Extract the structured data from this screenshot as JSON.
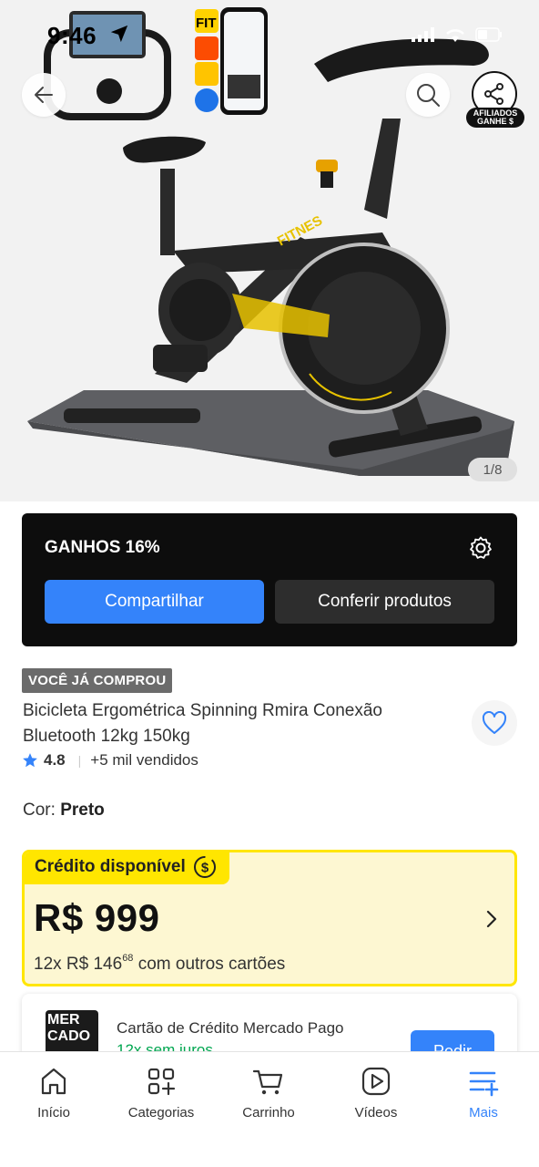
{
  "status_bar": {
    "time": "9:46"
  },
  "hero": {
    "affiliate_badge_line1": "AFILIADOS",
    "affiliate_badge_line2": "GANHE $",
    "image_counter": "1/8",
    "product_print": "FITNES"
  },
  "affiliate_panel": {
    "title": "GANHOS 16%",
    "share_label": "Compartilhar",
    "check_products_label": "Conferir produtos"
  },
  "product": {
    "bought_tag": "VOCÊ JÁ COMPROU",
    "title": "Bicicleta Ergométrica Spinning Rmira Conexão Bluetooth 12kg 150kg",
    "rating": "4.8",
    "sold": "+5 mil vendidos",
    "color_label": "Cor: ",
    "color_value": "Preto"
  },
  "credit": {
    "tab_label": "Crédito disponível",
    "price": "R$ 999",
    "installments_prefix": "12x R$ 146",
    "installments_cents": "68",
    "installments_suffix": " com outros cartões"
  },
  "mercado_pago": {
    "logo_text_1": "MER",
    "logo_text_2": "CADO",
    "title": "Cartão de Crédito Mercado Pago",
    "subtitle": "12x sem juros",
    "button_label": "Pedir"
  },
  "bottom_nav": {
    "items": [
      {
        "label": "Início"
      },
      {
        "label": "Categorias"
      },
      {
        "label": "Carrinho"
      },
      {
        "label": "Vídeos"
      },
      {
        "label": "Mais"
      }
    ],
    "active_index": 4
  },
  "colors": {
    "accent_blue": "#3483fa",
    "credit_yellow": "#ffe600",
    "success_green": "#00a650"
  }
}
